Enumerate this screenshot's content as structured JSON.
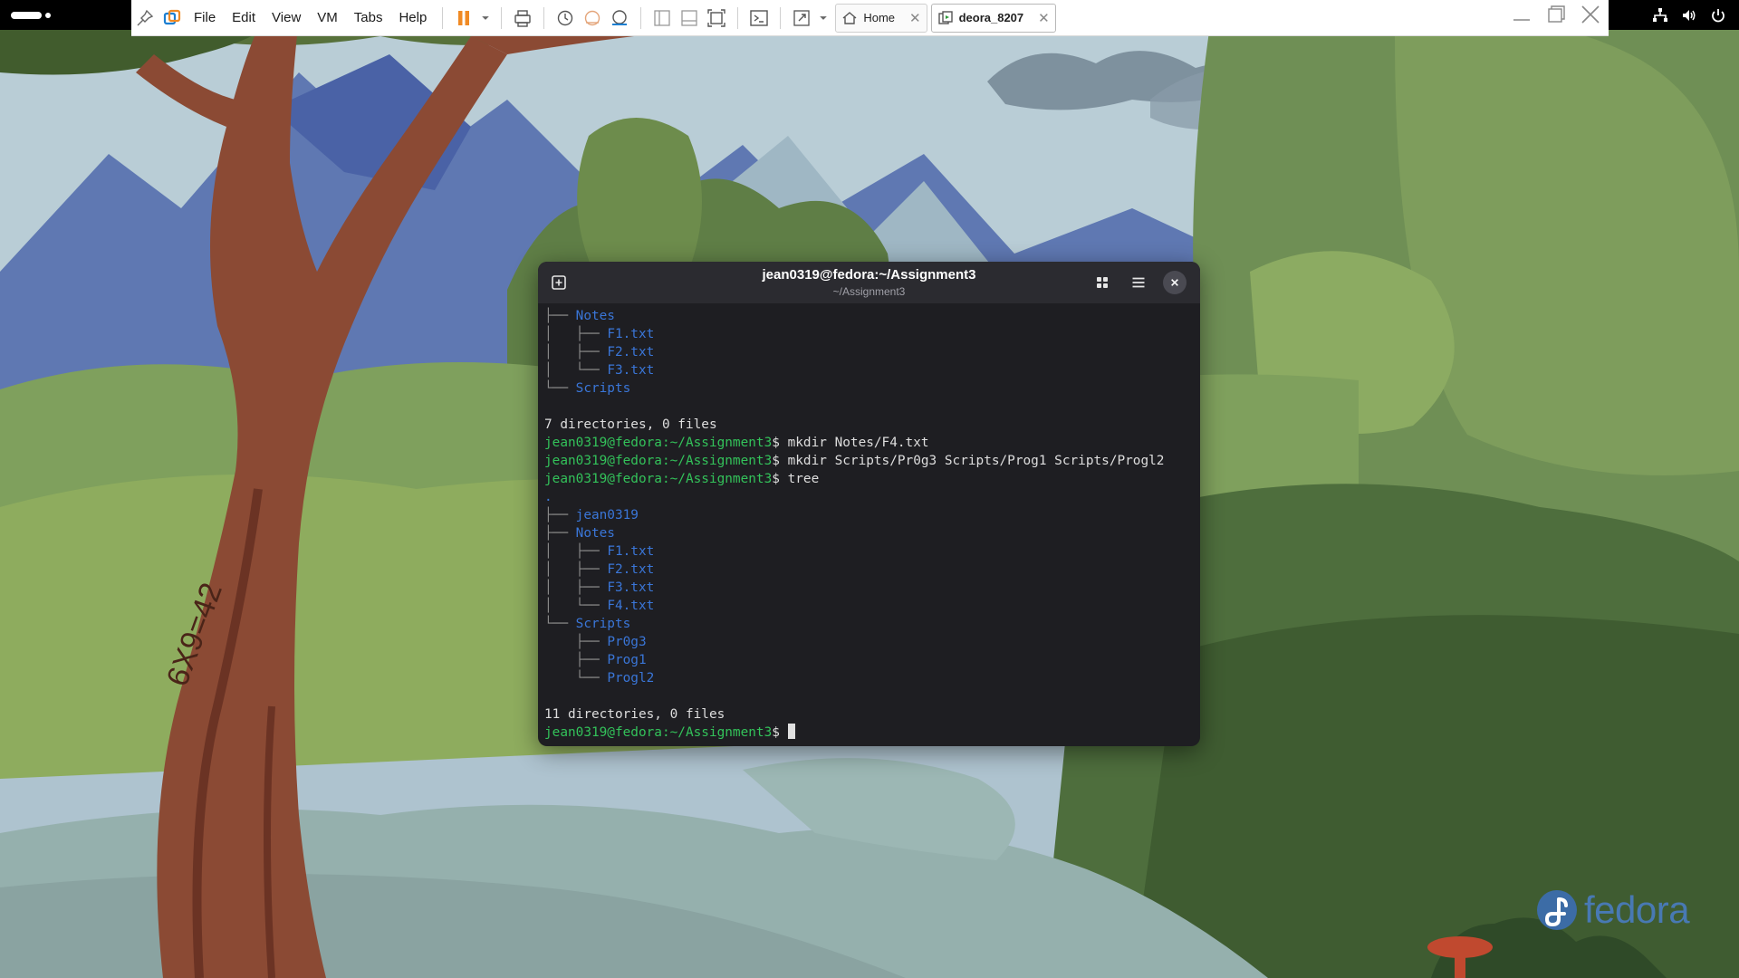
{
  "toolbar": {
    "menus": [
      "File",
      "Edit",
      "View",
      "VM",
      "Tabs",
      "Help"
    ],
    "tabs": [
      {
        "label": "Home",
        "active": false,
        "close": "✕"
      },
      {
        "label": "deora_8207",
        "active": true,
        "close": "✕"
      }
    ]
  },
  "terminal": {
    "title": "jean0319@fedora:~/Assignment3",
    "subtitle": "~/Assignment3",
    "prompt": "jean0319@fedora:~/Assignment3",
    "lines": [
      {
        "segments": [
          {
            "t": "├── ",
            "c": "dim"
          },
          {
            "t": "Notes",
            "c": "blue"
          }
        ]
      },
      {
        "segments": [
          {
            "t": "│   ├── ",
            "c": "dim"
          },
          {
            "t": "F1.txt",
            "c": "blue"
          }
        ]
      },
      {
        "segments": [
          {
            "t": "│   ├── ",
            "c": "dim"
          },
          {
            "t": "F2.txt",
            "c": "blue"
          }
        ]
      },
      {
        "segments": [
          {
            "t": "│   └── ",
            "c": "dim"
          },
          {
            "t": "F3.txt",
            "c": "blue"
          }
        ]
      },
      {
        "segments": [
          {
            "t": "└── ",
            "c": "dim"
          },
          {
            "t": "Scripts",
            "c": "blue"
          }
        ]
      },
      {
        "segments": [
          {
            "t": "",
            "c": ""
          }
        ]
      },
      {
        "segments": [
          {
            "t": "7 directories, 0 files",
            "c": ""
          }
        ]
      },
      {
        "segments": [
          {
            "t": "jean0319@fedora:~/Assignment3",
            "c": "green"
          },
          {
            "t": "$ mkdir Notes/F4.txt",
            "c": ""
          }
        ]
      },
      {
        "segments": [
          {
            "t": "jean0319@fedora:~/Assignment3",
            "c": "green"
          },
          {
            "t": "$ mkdir Scripts/Pr0g3 Scripts/Prog1 Scripts/Progl2",
            "c": ""
          }
        ]
      },
      {
        "segments": [
          {
            "t": "jean0319@fedora:~/Assignment3",
            "c": "green"
          },
          {
            "t": "$ tree",
            "c": ""
          }
        ]
      },
      {
        "segments": [
          {
            "t": ".",
            "c": "blue"
          }
        ]
      },
      {
        "segments": [
          {
            "t": "├── ",
            "c": "dim"
          },
          {
            "t": "jean0319",
            "c": "blue"
          }
        ]
      },
      {
        "segments": [
          {
            "t": "├── ",
            "c": "dim"
          },
          {
            "t": "Notes",
            "c": "blue"
          }
        ]
      },
      {
        "segments": [
          {
            "t": "│   ├── ",
            "c": "dim"
          },
          {
            "t": "F1.txt",
            "c": "blue"
          }
        ]
      },
      {
        "segments": [
          {
            "t": "│   ├── ",
            "c": "dim"
          },
          {
            "t": "F2.txt",
            "c": "blue"
          }
        ]
      },
      {
        "segments": [
          {
            "t": "│   ├── ",
            "c": "dim"
          },
          {
            "t": "F3.txt",
            "c": "blue"
          }
        ]
      },
      {
        "segments": [
          {
            "t": "│   └── ",
            "c": "dim"
          },
          {
            "t": "F4.txt",
            "c": "blue"
          }
        ]
      },
      {
        "segments": [
          {
            "t": "└── ",
            "c": "dim"
          },
          {
            "t": "Scripts",
            "c": "blue"
          }
        ]
      },
      {
        "segments": [
          {
            "t": "    ├── ",
            "c": "dim"
          },
          {
            "t": "Pr0g3",
            "c": "blue"
          }
        ]
      },
      {
        "segments": [
          {
            "t": "    ├── ",
            "c": "dim"
          },
          {
            "t": "Prog1",
            "c": "blue"
          }
        ]
      },
      {
        "segments": [
          {
            "t": "    └── ",
            "c": "dim"
          },
          {
            "t": "Progl2",
            "c": "blue"
          }
        ]
      },
      {
        "segments": [
          {
            "t": "",
            "c": ""
          }
        ]
      },
      {
        "segments": [
          {
            "t": "11 directories, 0 files",
            "c": ""
          }
        ]
      }
    ],
    "final_prompt_suffix": "$ "
  },
  "desktop": {
    "logo_text": "fedora",
    "tree_carving": "6X9=42"
  },
  "colors": {
    "terminal_bg": "#1e1e22",
    "header_bg": "#2b2b30",
    "prompt_green": "#33c25a",
    "dir_blue": "#3a76d8",
    "pause_orange": "#f08a24"
  },
  "icons": [
    "pin-icon",
    "vmware-library-icon",
    "pause-icon",
    "dropdown-icon",
    "send-ctrl-alt-del-icon",
    "snapshot-icon",
    "revert-snapshot-icon",
    "snapshot-manager-icon",
    "sidebar-icon",
    "thumbnail-bar-icon",
    "fit-guest-icon",
    "console-icon",
    "fullscreen-icon",
    "home-icon",
    "vm-icon",
    "minimize-icon",
    "restore-icon",
    "close-icon",
    "network-icon",
    "volume-icon",
    "power-icon",
    "new-tab-icon",
    "view-grid-icon",
    "hamburger-menu-icon",
    "fedora-logo-icon"
  ]
}
